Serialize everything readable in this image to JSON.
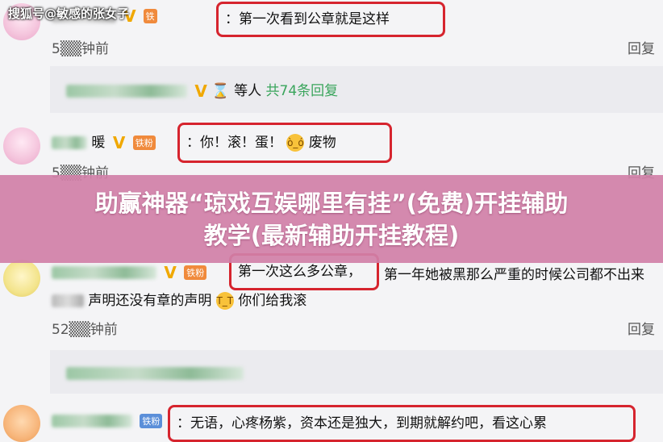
{
  "watermark": "搜狐号@敏感的张女子",
  "comments": [
    {
      "text": "：第一次看到公章就是这样",
      "time": "5▒▒钟前",
      "reply": "回复"
    },
    {
      "sub_reply": {
        "vip": "V",
        "icon": "hourglass-icon",
        "text": "等人",
        "count_text": "共74条回复"
      }
    },
    {
      "name_suffix": "暖",
      "vip": "V",
      "badge": "铁粉",
      "text_before": "：你！滚！蛋！",
      "text_after": "废物",
      "time": "5▒▒钟前",
      "reply": "回复"
    },
    {
      "vip": "V",
      "badge": "铁粉",
      "boxed_text": "第一次这么多公章，",
      "trailing_text": "第一年她被黑那么严重的时候公司都不出来",
      "line2_before": "声明还没有章的声明",
      "line2_after": "你们给我滚",
      "time": "52▒▒钟前",
      "reply": "回复"
    },
    {
      "badge": "铁粉",
      "text": "：无语，心疼杨紫，资本还是独大，到期就解约吧，看这心累"
    }
  ],
  "banner": {
    "line1": "助赢神器“琼戏互娱哪里有挂”(免费)开挂辅助",
    "line2": "教学(最新辅助开挂教程)"
  },
  "colors": {
    "highlight_box": "#d6242e",
    "banner_bg": "#d180a8",
    "vip": "#f0a800",
    "reply_count": "#3aa55c"
  }
}
